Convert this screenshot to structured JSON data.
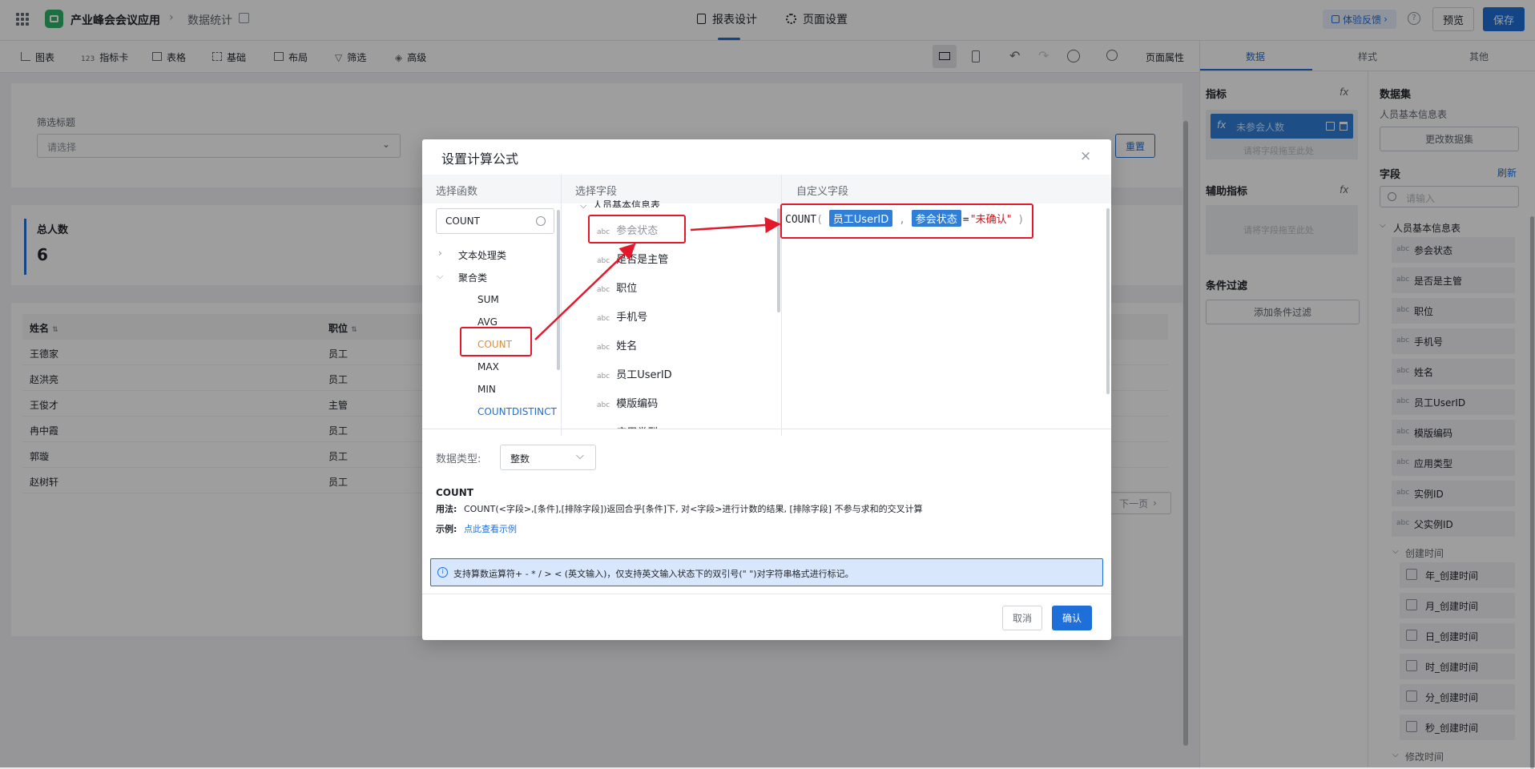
{
  "topbar": {
    "app_name": "产业峰会会议应用",
    "page_name": "数据统计",
    "tab_report": "报表设计",
    "tab_page": "页面设置",
    "feedback": "体验反馈",
    "preview": "预览",
    "save": "保存"
  },
  "toolbar": {
    "items": [
      "图表",
      "指标卡",
      "表格",
      "基础",
      "布局",
      "筛选",
      "高级"
    ],
    "page_props": "页面属性"
  },
  "canvas": {
    "filter_label": "筛选标题",
    "filter_placeholder": "请选择",
    "reset": "重置",
    "kpi_title": "总人数",
    "kpi_value": "6",
    "table_headers": [
      "姓名",
      "职位"
    ],
    "table_rows": [
      [
        "王德家",
        "员工"
      ],
      [
        "赵洪亮",
        "员工"
      ],
      [
        "王俊才",
        "主管"
      ],
      [
        "冉中霞",
        "员工"
      ],
      [
        "郭璇",
        "员工"
      ],
      [
        "赵树轩",
        "员工"
      ]
    ],
    "next_page": "下一页"
  },
  "rightpanel": {
    "tabs": [
      "数据",
      "样式",
      "其他"
    ],
    "metric_title": "指标",
    "metric_chip": "未参会人数",
    "drop_hint": "请将字段拖至此处",
    "aux_title": "辅助指标",
    "aux_drop": "请将字段拖至此处",
    "cond_title": "条件过滤",
    "add_cond": "添加条件过滤",
    "dataset_title": "数据集",
    "dataset_name": "人员基本信息表",
    "change_dataset": "更改数据集",
    "fields_title": "字段",
    "refresh": "刷新",
    "search_placeholder": "请输入",
    "group_name": "人员基本信息表",
    "fields": [
      "参会状态",
      "是否是主管",
      "职位",
      "手机号",
      "姓名",
      "员工UserID",
      "模版编码",
      "应用类型",
      "实例ID",
      "父实例ID"
    ],
    "created_group": "创建时间",
    "date_fields": [
      "年_创建时间",
      "月_创建时间",
      "日_创建时间",
      "时_创建时间",
      "分_创建时间",
      "秒_创建时间"
    ],
    "modified_group": "修改时间"
  },
  "dialog": {
    "title": "设置计算公式",
    "col_func": "选择函数",
    "col_field": "选择字段",
    "col_custom": "自定义字段",
    "func_search": "COUNT",
    "cat_text": "文本处理类",
    "cat_agg": "聚合类",
    "functions": [
      "SUM",
      "AVG",
      "COUNT",
      "MAX",
      "MIN",
      "COUNTDISTINCT"
    ],
    "field_group": "人员基本信息表",
    "field_list": [
      "参会状态",
      "是否是主管",
      "职位",
      "手机号",
      "姓名",
      "员工UserID",
      "模版编码",
      "应用类型"
    ],
    "abc": "abc",
    "formula": {
      "fn": "COUNT",
      "arg1": "员工UserID",
      "arg2": "参会状态",
      "op": "=",
      "literal": "\"未确认\""
    },
    "type_label": "数据类型:",
    "type_value": "整数",
    "help_name": "COUNT",
    "usage_label": "用法:",
    "usage_text": "COUNT(<字段>,[条件],[排除字段])返回合乎[条件]下, 对<字段>进行计数的结果, [排除字段] 不参与求和的交叉计算",
    "example_label": "示例:",
    "example_link": "点此查看示例",
    "info": "支持算数运算符+ - * / > < (英文输入)，仅支持英文输入状态下的双引号(\" \")对字符串格式进行标记。",
    "cancel": "取消",
    "confirm": "确认"
  },
  "colors": {
    "primary": "#1e6fd9",
    "highlight": "#e3192b",
    "orange": "#e88a2e"
  }
}
